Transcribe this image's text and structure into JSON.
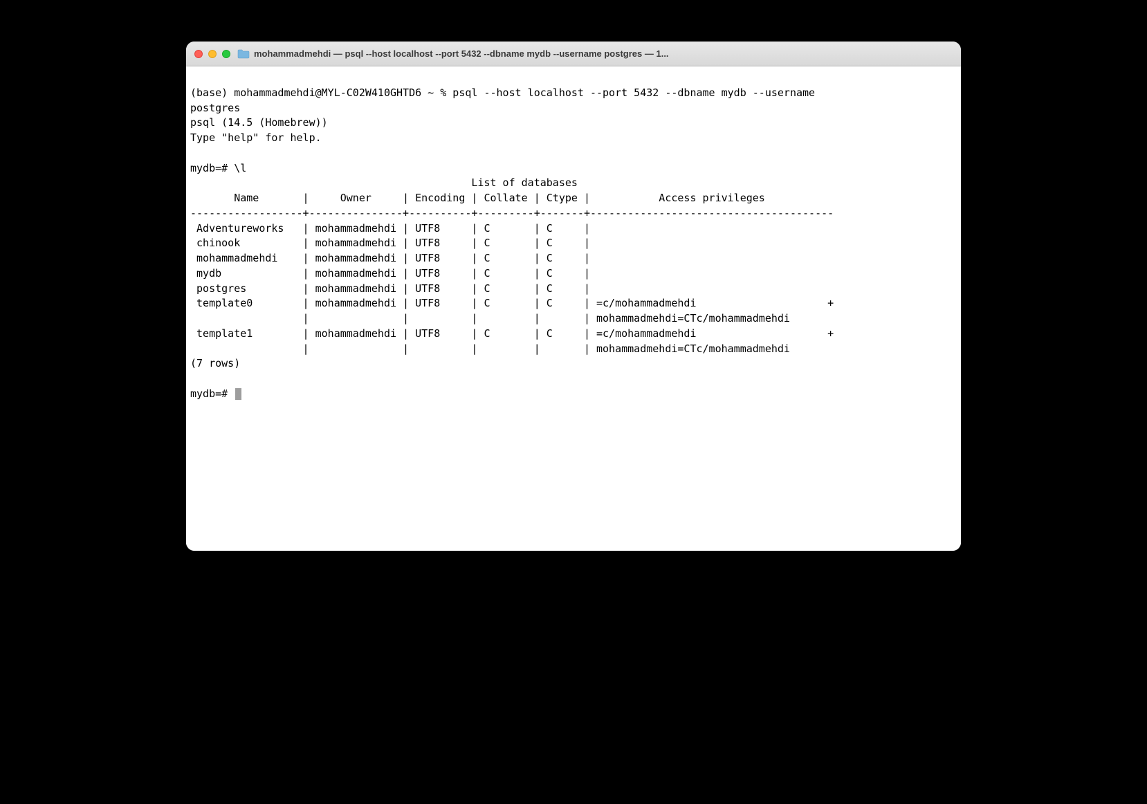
{
  "window": {
    "title": "mohammadmehdi — psql --host localhost --port 5432 --dbname mydb --username postgres — 1..."
  },
  "terminal": {
    "prompt_line": "(base) mohammadmehdi@MYL-C02W410GHTD6 ~ % psql --host localhost --port 5432 --dbname mydb --username ",
    "prompt_cont": "postgres",
    "version": "psql (14.5 (Homebrew))",
    "help_hint": "Type \"help\" for help.",
    "db_prompt": "mydb=# \\l",
    "db_prompt2": "mydb=# ",
    "table_title": "                                             List of databases",
    "header": "       Name       |     Owner     | Encoding | Collate | Ctype |           Access privileges           ",
    "separator": "------------------+---------------+----------+---------+-------+---------------------------------------",
    "rows": [
      " Adventureworks   | mohammadmehdi | UTF8     | C       | C     | ",
      " chinook          | mohammadmehdi | UTF8     | C       | C     | ",
      " mohammadmehdi    | mohammadmehdi | UTF8     | C       | C     | ",
      " mydb             | mohammadmehdi | UTF8     | C       | C     | ",
      " postgres         | mohammadmehdi | UTF8     | C       | C     | ",
      " template0        | mohammadmehdi | UTF8     | C       | C     | =c/mohammadmehdi                     +",
      "                  |               |          |         |       | mohammadmehdi=CTc/mohammadmehdi",
      " template1        | mohammadmehdi | UTF8     | C       | C     | =c/mohammadmehdi                     +",
      "                  |               |          |         |       | mohammadmehdi=CTc/mohammadmehdi"
    ],
    "rowcount": "(7 rows)"
  }
}
